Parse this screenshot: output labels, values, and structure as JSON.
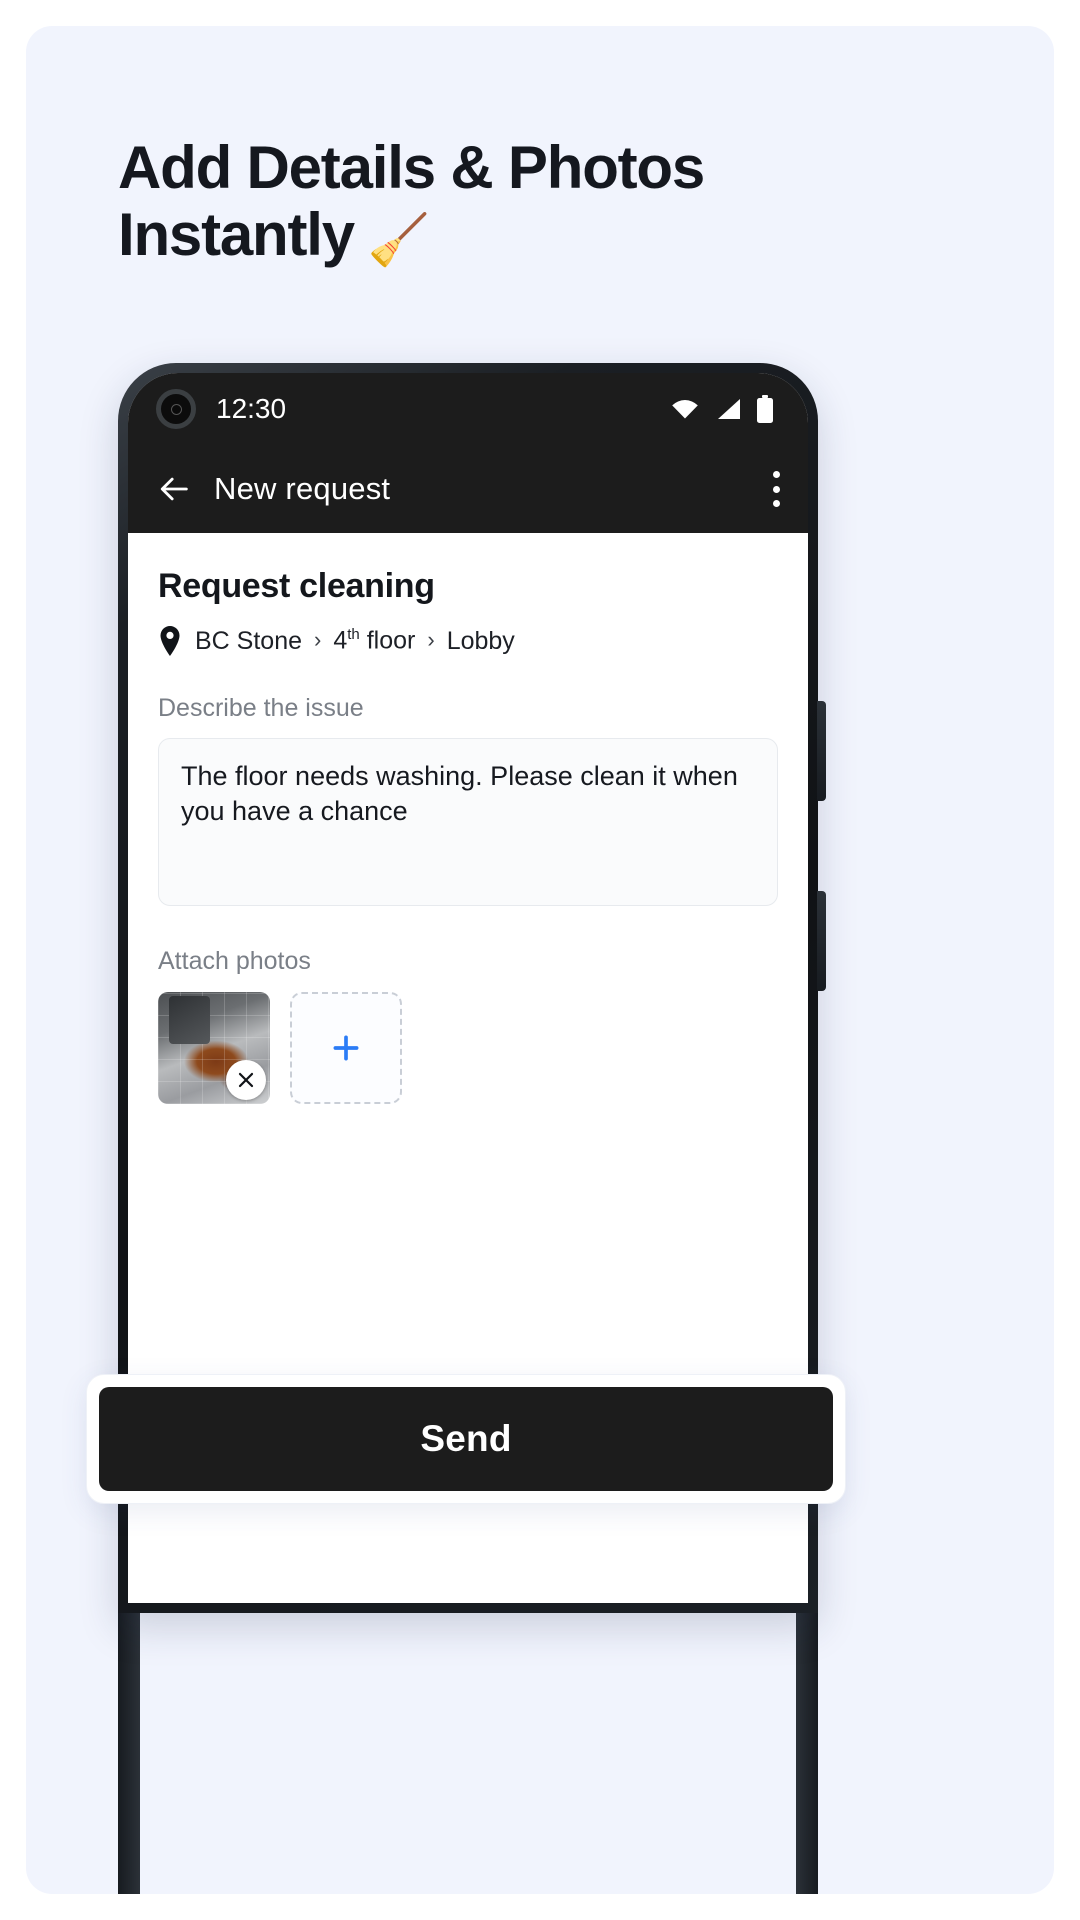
{
  "promo": {
    "headline_line1": "Add Details & Photos",
    "headline_line2": "Instantly",
    "headline_emoji": "🧹",
    "background_color": "#f1f4fd"
  },
  "phone": {
    "status_bar": {
      "time": "12:30",
      "icons": [
        "wifi-icon",
        "cellular-signal-icon",
        "battery-icon"
      ],
      "background_color": "#1c1c1c"
    },
    "app_bar": {
      "back_label": "back-arrow-icon",
      "title": "New request",
      "overflow_label": "overflow-menu-icon"
    },
    "form": {
      "title": "Request cleaning",
      "breadcrumb": {
        "pin_icon": "location-pin-icon",
        "separator": "›",
        "crumbs": [
          {
            "text": "BC Stone",
            "sup": ""
          },
          {
            "text": "4",
            "sup": "th",
            "suffix": " floor"
          },
          {
            "text": "Lobby",
            "sup": ""
          }
        ]
      },
      "describe_label": "Describe the issue",
      "describe_value": "The floor needs washing. Please clean it when you have a chance",
      "describe_placeholder": "Describe the issue",
      "attach_label": "Attach photos",
      "photos": [
        {
          "name": "floor-stain-photo",
          "remove_icon": "close-icon"
        }
      ],
      "add_photo_label": "+"
    },
    "send_button_label": "Send"
  },
  "colors": {
    "accent_blue": "#2b7cf6",
    "dark": "#1c1c1c",
    "muted_text": "#7a7f87",
    "emoji_orange": "#ef512a"
  }
}
